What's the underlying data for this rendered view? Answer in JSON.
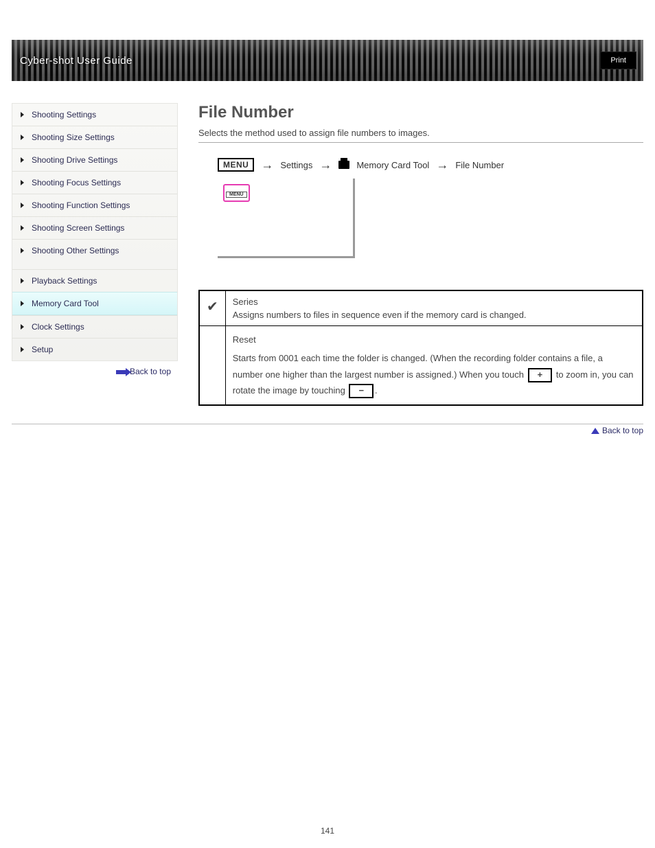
{
  "header": {
    "title": "Cyber-shot User Guide",
    "print": "Print"
  },
  "sidebar": {
    "items": [
      {
        "label": "Shooting Settings"
      },
      {
        "label": "Shooting Size Settings"
      },
      {
        "label": "Shooting Drive Settings"
      },
      {
        "label": "Shooting Focus Settings"
      },
      {
        "label": "Shooting Function Settings"
      },
      {
        "label": "Shooting Screen Settings"
      },
      {
        "label": "Shooting Other Settings"
      },
      {
        "label": "Playback Settings"
      },
      {
        "label": "Memory Card Tool"
      },
      {
        "label": "Clock Settings"
      },
      {
        "label": "Setup"
      }
    ],
    "active_index": 8,
    "back": "Back to top"
  },
  "content": {
    "title": "File Number",
    "desc": "Selects the method used to assign file numbers to images.",
    "path": {
      "menu_label": "MENU",
      "step1": "Settings",
      "step2_label": "Memory",
      "step2_suffix": "Card Tool",
      "step3": "File Number"
    },
    "screen_menu": "MENU",
    "table": {
      "row1_key": "✔",
      "row1_cell1": "Series",
      "row1_cell2": "Assigns numbers to files in sequence even if the memory card is changed.",
      "row2_cell1": "Reset",
      "row2_cell2_a": "Starts from 0001 each time the folder is changed. (When the recording folder contains a file, a number one higher than the largest number is assigned.) When you touch",
      "row2_plus": "+",
      "row2_cell2_b": "to zoom in, you can rotate the image by touching",
      "row2_minus": "−",
      "row2_cell2_c": "."
    }
  },
  "footer": {
    "back_top": "Back to top",
    "page_number": "141"
  }
}
